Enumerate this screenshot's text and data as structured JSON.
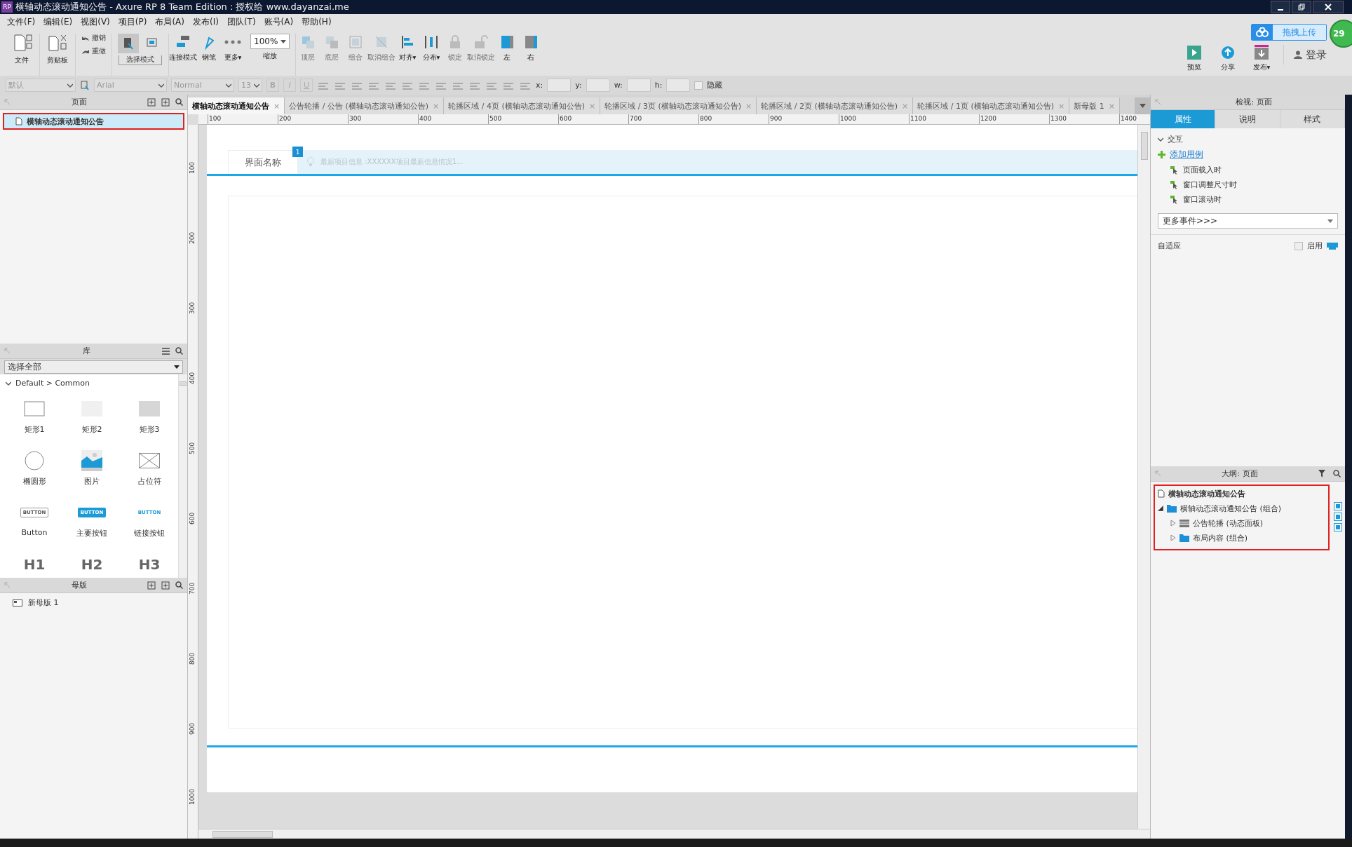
{
  "window": {
    "app_badge": "RP",
    "title": "横轴动态滚动通知公告 - Axure RP 8 Team Edition : 授权给 www.dayanzai.me"
  },
  "menu": [
    "文件(F)",
    "编辑(E)",
    "视图(V)",
    "项目(P)",
    "布局(A)",
    "发布(I)",
    "团队(T)",
    "账号(A)",
    "帮助(H)"
  ],
  "toolbar": [
    {
      "kind": "file",
      "label": "文件"
    },
    {
      "kind": "clipboard",
      "label": "剪贴板"
    },
    {
      "kind": "history",
      "items": [
        "撤销",
        "重做"
      ]
    },
    {
      "kind": "mode",
      "label": "选择模式",
      "modes": [
        {
          "selected": true
        },
        {
          "selected": false
        }
      ]
    },
    {
      "kind": "tool",
      "label": "连接模式",
      "disabled": false
    },
    {
      "kind": "tool",
      "label": "钢笔",
      "disabled": false
    },
    {
      "kind": "tool",
      "label": "更多▾",
      "disabled": false
    },
    {
      "kind": "zoom",
      "value": "100%",
      "label": "缩放"
    },
    {
      "kind": "tool",
      "label": "顶层",
      "disabled": true
    },
    {
      "kind": "tool",
      "label": "底层",
      "disabled": true
    },
    {
      "kind": "tool",
      "label": "组合",
      "disabled": true
    },
    {
      "kind": "tool",
      "label": "取消组合",
      "disabled": true
    },
    {
      "kind": "tool",
      "label": "对齐▾",
      "disabled": false
    },
    {
      "kind": "tool",
      "label": "分布▾",
      "disabled": false
    },
    {
      "kind": "tool",
      "label": "锁定",
      "disabled": true
    },
    {
      "kind": "tool",
      "label": "取消锁定",
      "disabled": true
    },
    {
      "kind": "tool",
      "label": "左",
      "disabled": false
    },
    {
      "kind": "tool",
      "label": "右",
      "disabled": false
    }
  ],
  "cloud": {
    "upload": "拖拽上传",
    "actions": [
      "预览",
      "分享",
      "发布▾"
    ],
    "login": "登录",
    "badge": "29"
  },
  "format": {
    "preset": "默认",
    "font": "Arial",
    "style": "Normal",
    "size": "13",
    "bold": "B",
    "italic": "I",
    "underline": "U",
    "x_label": "x:",
    "y_label": "y:",
    "w_label": "w:",
    "h_label": "h:",
    "hidden_label": "隐藏",
    "hidden": false
  },
  "pages": {
    "title": "页面",
    "items": [
      {
        "label": "横轴动态滚动通知公告",
        "selected": true
      }
    ]
  },
  "tabs": [
    {
      "label": "横轴动态滚动通知公告",
      "selected": true,
      "close": "×"
    },
    {
      "label": "公告轮播 / 公告 (横轴动态滚动通知公告)",
      "selected": false,
      "close": "×"
    },
    {
      "label": "轮播区域 / 4页 (横轴动态滚动通知公告)",
      "selected": false,
      "close": "×"
    },
    {
      "label": "轮播区域 / 3页 (横轴动态滚动通知公告)",
      "selected": false,
      "close": "×"
    },
    {
      "label": "轮播区域 / 2页 (横轴动态滚动通知公告)",
      "selected": false,
      "close": "×"
    },
    {
      "label": "轮播区域 / 1页 (横轴动态滚动通知公告)",
      "selected": false,
      "close": "×"
    },
    {
      "label": "新母版 1",
      "selected": false,
      "close": "×"
    }
  ],
  "ruler": {
    "horizontal": [
      "100",
      "200",
      "300",
      "400",
      "500",
      "600",
      "700",
      "800",
      "900",
      "1000",
      "1100",
      "1200",
      "1300",
      "1400"
    ],
    "vertical": [
      "100",
      "200",
      "300",
      "400",
      "500",
      "600",
      "700",
      "800",
      "900",
      "1000"
    ]
  },
  "canvas": {
    "tab_label": "界面名称",
    "badge": "1",
    "notice": "最新项目信息 :XXXXXX项目最新信息情况1..."
  },
  "library": {
    "title": "库",
    "filter": "选择全部",
    "group": "Default > Common",
    "group_expanded": true,
    "widgets": [
      {
        "kind": "rect",
        "label": "矩形1"
      },
      {
        "kind": "rect-light",
        "label": "矩形2"
      },
      {
        "kind": "rect-grey",
        "label": "矩形3"
      },
      {
        "kind": "ellipse",
        "label": "椭圆形"
      },
      {
        "kind": "image",
        "label": "图片"
      },
      {
        "kind": "placeholder",
        "label": "占位符"
      },
      {
        "kind": "button",
        "label": "Button",
        "preview": "BUTTON"
      },
      {
        "kind": "primary-button",
        "label": "主要按钮",
        "preview": "BUTTON"
      },
      {
        "kind": "link-button",
        "label": "链接按钮",
        "preview": "BUTTON"
      },
      {
        "kind": "heading",
        "preview": "H1"
      },
      {
        "kind": "heading",
        "preview": "H2"
      },
      {
        "kind": "heading",
        "preview": "H3"
      }
    ]
  },
  "masters": {
    "title": "母版",
    "items": [
      "新母版 1"
    ]
  },
  "inspector": {
    "title": "检视: 页面",
    "tabs": [
      {
        "label": "属性",
        "selected": true
      },
      {
        "label": "说明",
        "selected": false
      },
      {
        "label": "样式",
        "selected": false
      }
    ],
    "section": {
      "label": "交互",
      "expanded": true
    },
    "add_case": "添加用例",
    "events": [
      "页面载入时",
      "窗口调整尺寸时",
      "窗口滚动时"
    ],
    "more_events": "更多事件>>>",
    "adaptive": {
      "label": "自适应",
      "checkbox_label": "启用",
      "checked": false
    }
  },
  "outline": {
    "title": "大纲: 页面",
    "tree": [
      {
        "kind": "page",
        "label": "横轴动态滚动通知公告"
      },
      {
        "kind": "group",
        "label": "横轴动态滚动通知公告 (组合)",
        "expanded": true,
        "children": [
          {
            "kind": "panel",
            "label": "公告轮播 (动态面板)",
            "expanded": false
          },
          {
            "kind": "group",
            "label": "布局内容 (组合)",
            "expanded": false
          }
        ]
      }
    ]
  }
}
